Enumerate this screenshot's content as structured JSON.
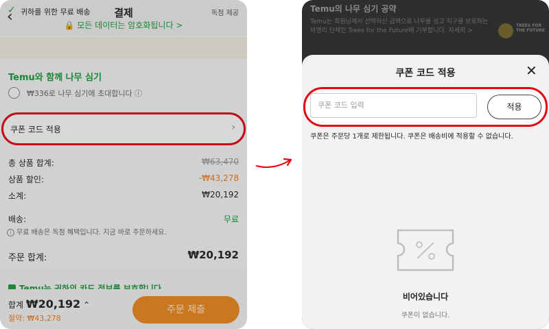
{
  "left": {
    "title": "결제",
    "secure_text": "🔒 모든 데이터는 암호화됩니다 >",
    "shipping": {
      "text": "귀하를 위한 무료 배송",
      "badge": "독점 제공"
    },
    "tree": {
      "title": "Temu와 함께 나무 심기",
      "invite": "₩336로 나무 심기에 초대합니다 ⓘ"
    },
    "coupon_label": "쿠폰 코드 적용",
    "summary": [
      {
        "label": "총 상품 합계:",
        "value": "₩63,470",
        "style": "strike"
      },
      {
        "label": "상품 할인:",
        "value": "-₩43,278",
        "style": "orange"
      },
      {
        "label": "소계:",
        "value": "₩20,192",
        "style": "normal"
      },
      {
        "label": "배송:",
        "value": "무료",
        "style": "green"
      }
    ],
    "shipping_note": "무료 배송은 독점 혜택입니다. 지금 바로 주문하세요.",
    "order_total_label": "주문 합계:",
    "order_total_value": "₩20,192",
    "protect_text": "Temu는 귀하의 카드 정보를 보호합니다",
    "bottom_total_prefix": "합계",
    "bottom_total_value": "₩20,192",
    "bottom_save": "절약: ₩43,278",
    "submit_label": "주문 제출"
  },
  "right": {
    "top_title": "Temu의 나무 심기 공약",
    "top_desc": "Temu는 회원님께서 선택하신 금액으로 나무를 심고 지구를 보호하는 비영리 단체인 Trees for the Future에 기부합니다. 자세히 >",
    "top_logo": "TREES FOR THE FUTURE",
    "sheet_title": "쿠폰 코드 적용",
    "input_placeholder": "쿠폰 코드 입력",
    "apply_label": "적용",
    "notice": "쿠폰은 주문당 1개로 제한됩니다. 쿠폰은 배송비에 적용할 수 없습니다.",
    "empty_title": "비어있습니다",
    "empty_sub": "쿠폰이 없습니다."
  },
  "colors": {
    "highlight": "#e60012",
    "accent_green": "#1a9a3a",
    "accent_orange": "#f07c1b"
  }
}
